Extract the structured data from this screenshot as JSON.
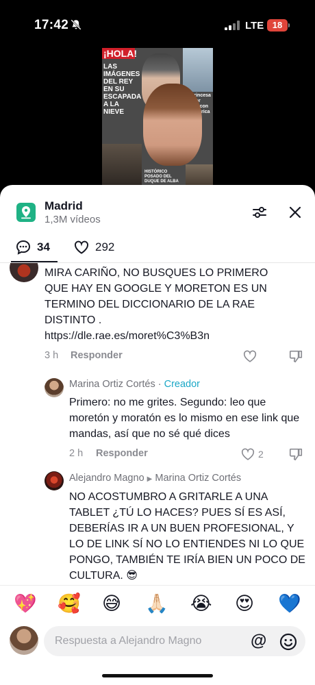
{
  "status_bar": {
    "time": "17:42",
    "network": "LTE",
    "battery": "18"
  },
  "video": {
    "magazine_title": "¡HOLA!",
    "headline": "Las imágenes del Rey en su escapada a la nieve",
    "side_text": "La princesa Leonor esbaracon en América",
    "bottom_text": "Histórico posado del duque de Alba"
  },
  "header": {
    "title": "Madrid",
    "subtitle": "1,3M vídeos"
  },
  "tabs": {
    "comments_count": "34",
    "likes_count": "292"
  },
  "comments": [
    {
      "text": "MIRA CARIÑO, NO BUSQUES LO PRIMERO QUE HAY EN GOOGLE Y MORETON ES UN TERMINO DEL DICCIONARIO DE LA RAE DISTINTO .\nhttps://dle.rae.es/moret%C3%B3n",
      "time": "3 h",
      "reply_label": "Responder"
    },
    {
      "author": "Marina Ortiz Cortés",
      "badge": "Creador",
      "text": "Primero: no me grites. Segundo: leo que moretón y moratón es lo mismo en ese link que mandas, así que no sé qué dices",
      "time": "2 h",
      "reply_label": "Responder",
      "likes": "2"
    },
    {
      "author": "Alejandro Magno",
      "reply_to": "Marina Ortiz Cortés",
      "text": "NO ACOSTUMBRO A GRITARLE A UNA TABLET ¿TÚ LO HACES? PUES SÍ ES ASÍ, DEBERÍAS IR A UN BUEN PROFESIONAL, Y LO DE LINK SÍ NO LO ENTIENDES NI LO QUE PONGO, TAMBIÉN TE IRÍA BIEN UN POCO DE CULTURA. 😎"
    }
  ],
  "emoji_bar": [
    "💖",
    "🥰",
    "😅",
    "🙏🏻",
    "😭",
    "😍",
    "💙"
  ],
  "input": {
    "placeholder": "Respuesta a Alejandro Magno",
    "at_symbol": "@"
  },
  "colors": {
    "accent": "#1fb285",
    "creator": "#1aa7c6",
    "battery": "#e0453a"
  }
}
